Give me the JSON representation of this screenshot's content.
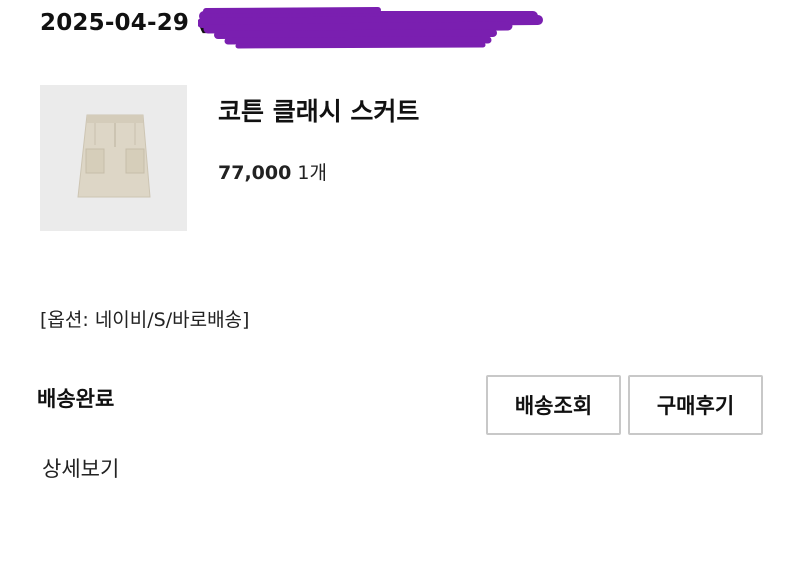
{
  "order": {
    "date": "2025-04-29 (2"
  },
  "product": {
    "name": "코튼 클래시 스커트",
    "price": "77,000",
    "quantity": "1개",
    "option": "[옵션: 네이비/S/바로배송]",
    "image_icon": "skirt-thumbnail"
  },
  "status": {
    "label": "배송완료"
  },
  "actions": {
    "track_label": "배송조회",
    "review_label": "구매후기",
    "detail_label": "상세보기"
  },
  "colors": {
    "redaction": "#7a1fb0",
    "button_border": "#c8c8c8",
    "thumb_bg": "#ebebeb",
    "skirt": "#ddd6c6"
  }
}
